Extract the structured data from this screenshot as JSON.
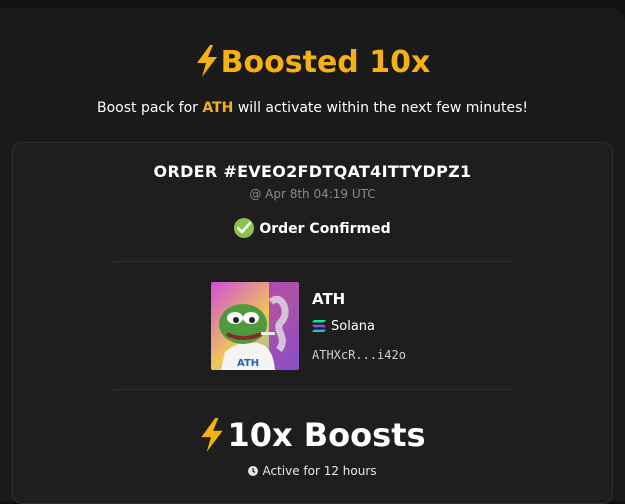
{
  "header": {
    "title": "Boosted 10x",
    "subtitle_prefix": "Boost pack for ",
    "token_symbol": "ATH",
    "subtitle_suffix": " will activate within the next few minutes!"
  },
  "order": {
    "id": "ORDER #EVEO2FDTQAT4ITTYDPZ1",
    "date": "@ Apr 8th 04:19 UTC",
    "status": "Order Confirmed"
  },
  "token": {
    "name": "ATH",
    "chain": "Solana",
    "address": "ATHXcR...i42o",
    "image_icon": "pepe-token-image"
  },
  "boost": {
    "label": "10x Boosts",
    "duration": "Active for 12 hours"
  },
  "colors": {
    "accent": "#f5b114",
    "success": "#8bc34a",
    "background": "#1a1a1a",
    "card": "#1e1e1e"
  }
}
